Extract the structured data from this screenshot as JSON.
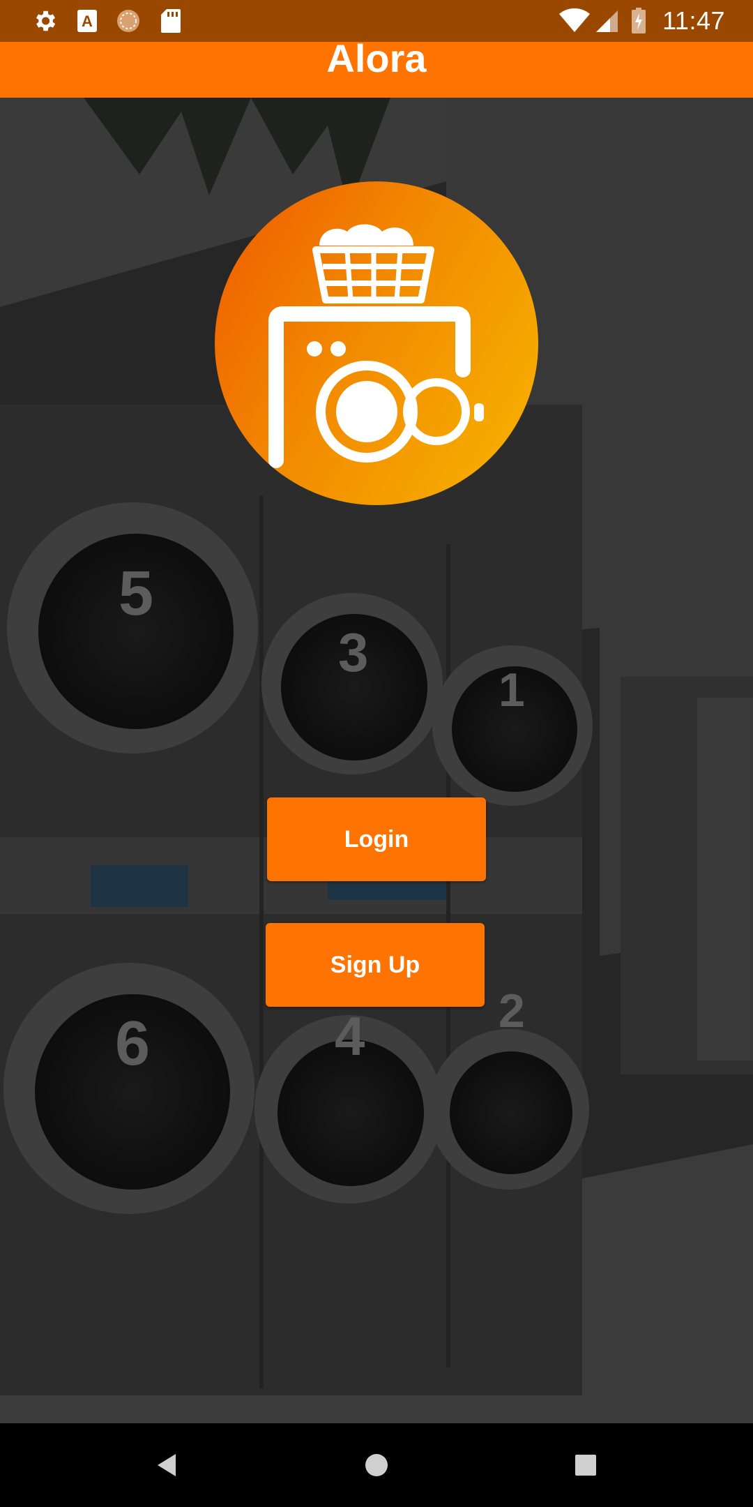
{
  "status_bar": {
    "time": "11:47",
    "left_icons": [
      "gear-icon",
      "font-a-icon",
      "sync-circle-icon",
      "sd-card-icon"
    ],
    "right_icons": [
      "wifi-icon",
      "cell-signal-icon",
      "battery-charging-icon"
    ]
  },
  "app_bar": {
    "title": "Alora",
    "color": "#ff7300"
  },
  "background": {
    "machine_numbers": [
      "5",
      "3",
      "1",
      "6",
      "4",
      "2"
    ]
  },
  "logo": {
    "icon": "laundry-machine-basket-icon",
    "gradient_start": "#ef5a00",
    "gradient_end": "#f7b500"
  },
  "actions": {
    "login_label": "Login",
    "signup_label": "Sign Up"
  },
  "nav_bar": {
    "icons": [
      "back-triangle-icon",
      "home-circle-icon",
      "recents-square-icon"
    ]
  }
}
